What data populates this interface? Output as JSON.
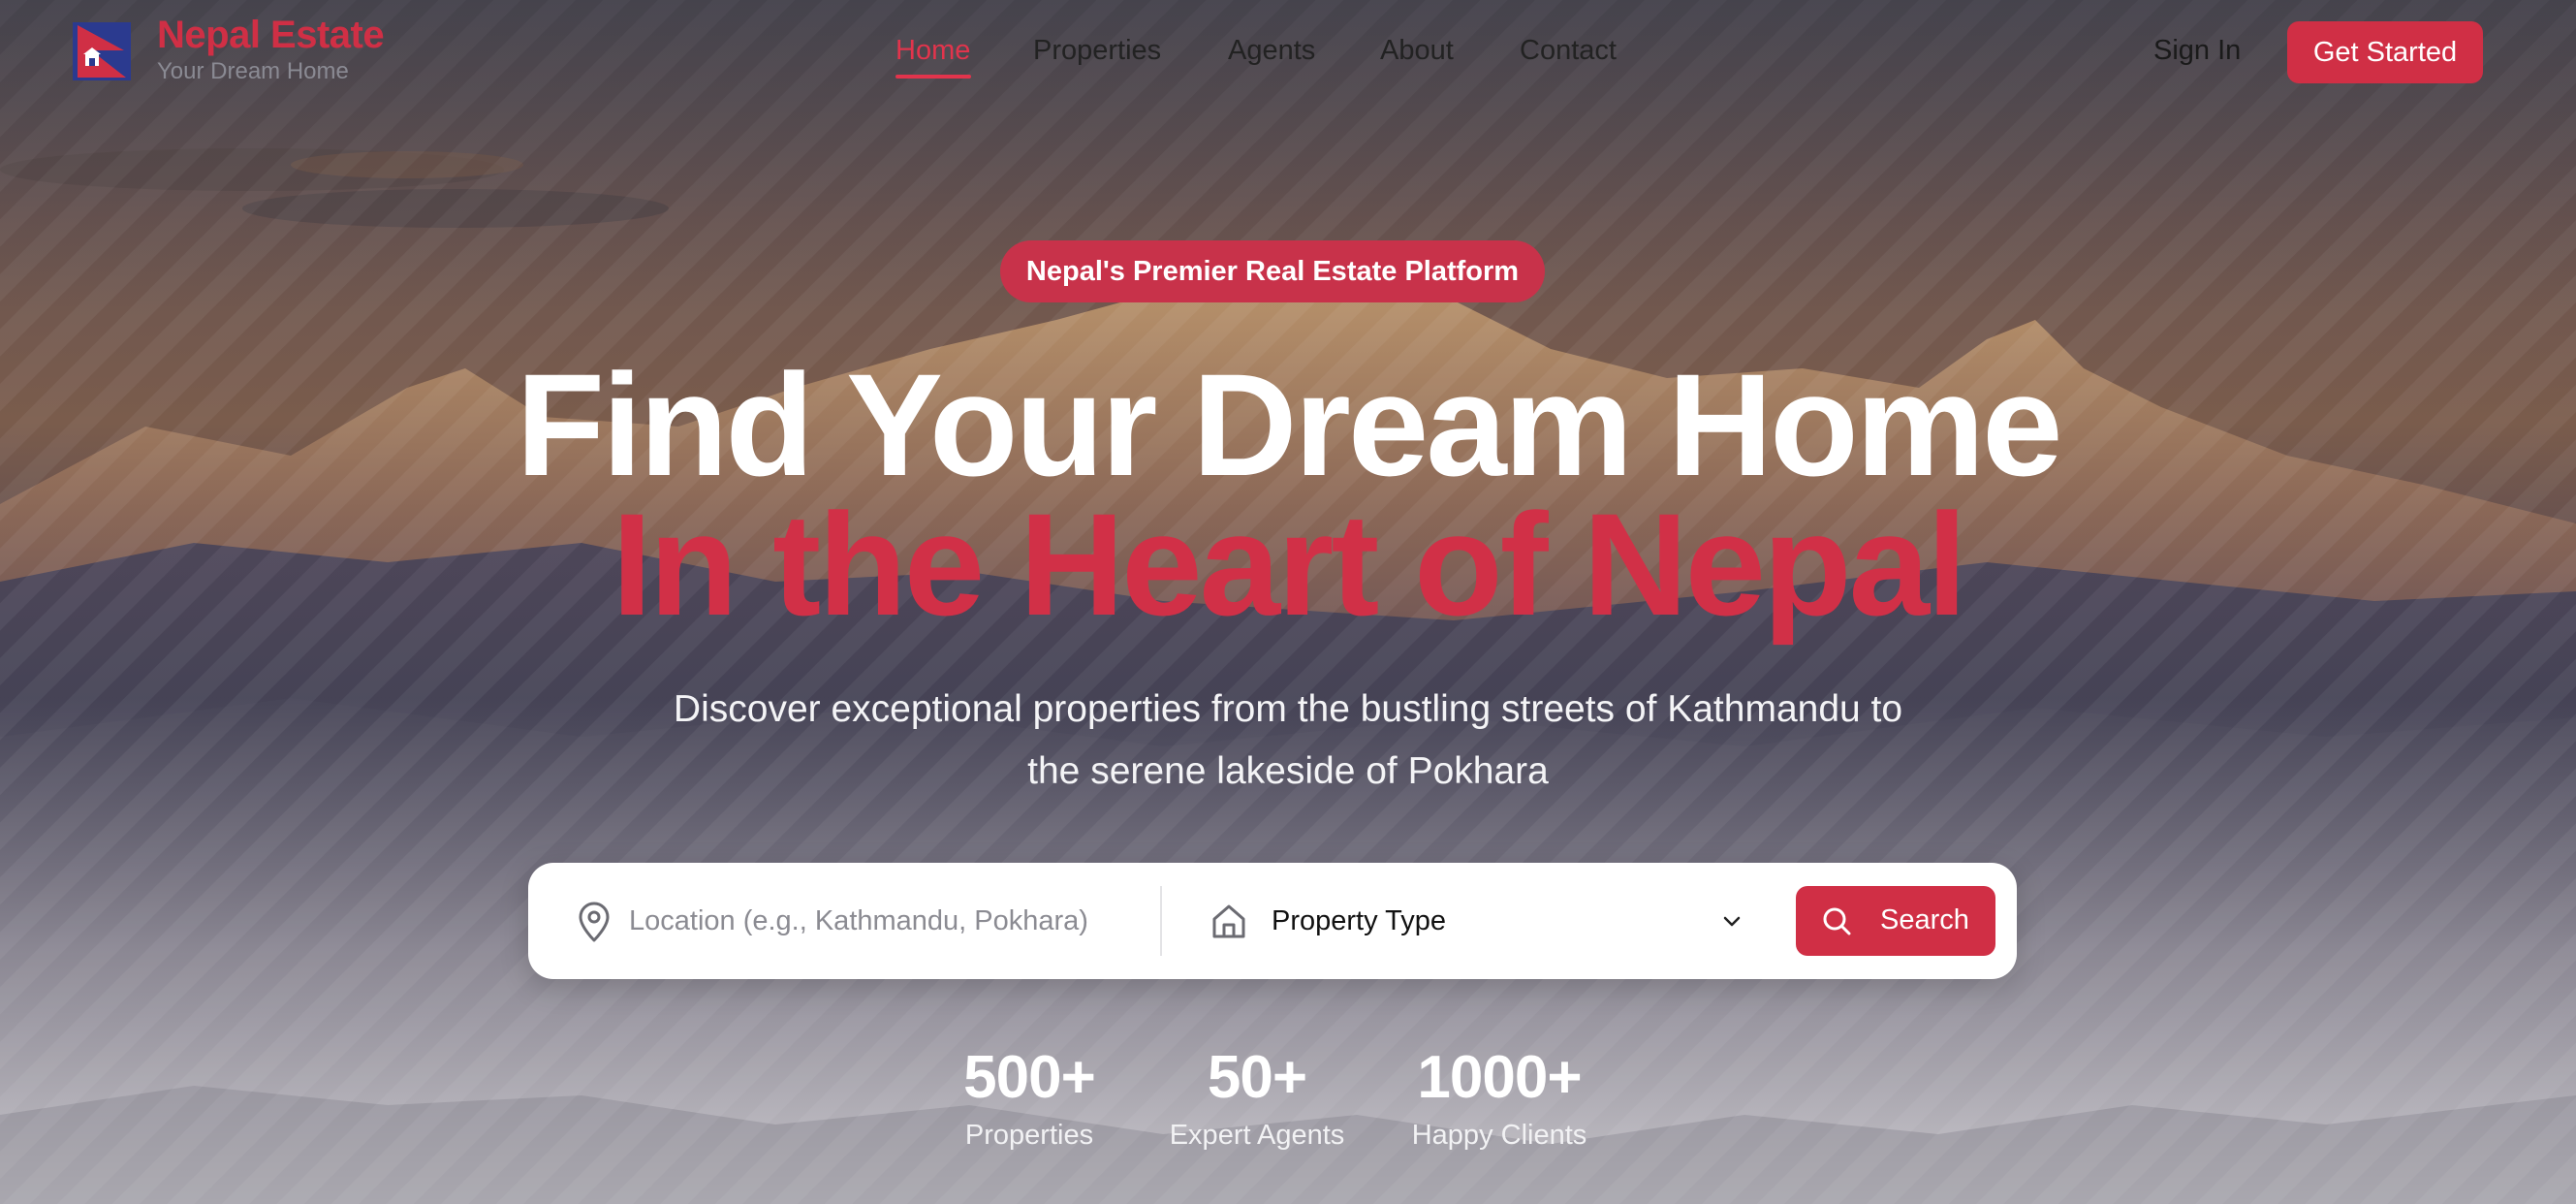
{
  "brand": {
    "name": "Nepal Estate",
    "tagline": "Your Dream Home"
  },
  "nav": {
    "links": [
      {
        "label": "Home",
        "active": true
      },
      {
        "label": "Properties",
        "active": false
      },
      {
        "label": "Agents",
        "active": false
      },
      {
        "label": "About",
        "active": false
      },
      {
        "label": "Contact",
        "active": false
      }
    ],
    "sign_in": "Sign In",
    "get_started": "Get Started"
  },
  "hero": {
    "badge": "Nepal's Premier Real Estate Platform",
    "headline_line1": "Find Your Dream Home",
    "headline_line2": "In the Heart of Nepal",
    "subtitle_line1": "Discover exceptional properties from the bustling streets of Kathmandu to",
    "subtitle_line2": "the serene lakeside of Pokhara"
  },
  "search": {
    "location_placeholder": "Location (e.g., Kathmandu, Pokhara)",
    "location_value": "",
    "property_type_label": "Property Type",
    "button_label": "Search"
  },
  "stats": [
    {
      "value": "500+",
      "label": "Properties"
    },
    {
      "value": "50+",
      "label": "Expert Agents"
    },
    {
      "value": "1000+",
      "label": "Happy Clients"
    }
  ],
  "icons": {
    "logo": "nepal-flag-logo-icon",
    "location": "map-pin-icon",
    "property_type": "home-icon",
    "dropdown": "chevron-down-icon",
    "search": "search-icon"
  },
  "colors": {
    "brand_red": "#d02f45",
    "headline_white": "#ffffff",
    "headline_red": "#d13047",
    "nav_text": "#222222",
    "tagline_gray": "#8a8a93"
  }
}
